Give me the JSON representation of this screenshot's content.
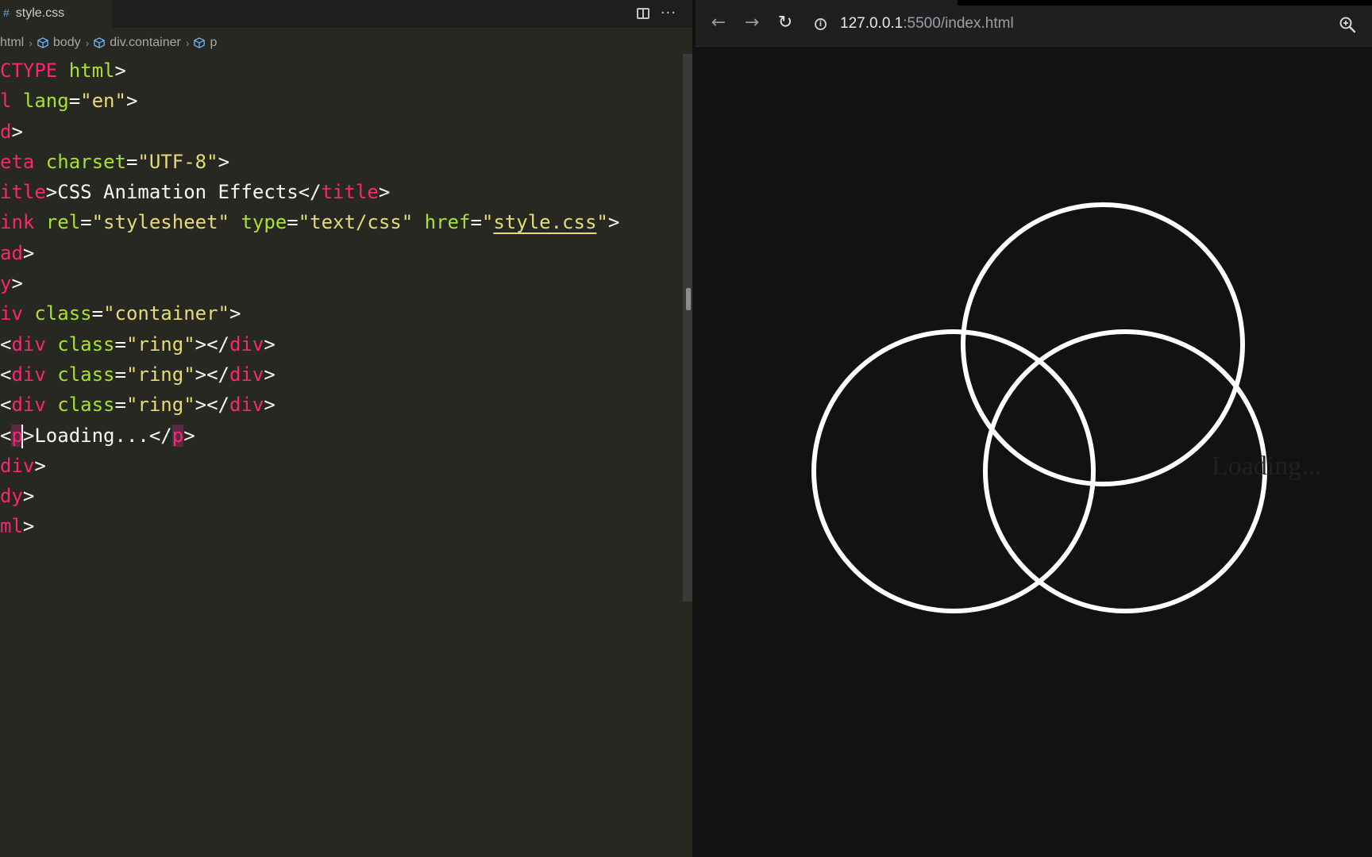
{
  "editor": {
    "tab_label": "style.css",
    "breadcrumb": [
      "html",
      "body",
      "div.container",
      "p"
    ],
    "lines": [
      [
        [
          "t",
          "CTYPE "
        ],
        [
          "a",
          "html"
        ],
        [
          "p",
          ">"
        ]
      ],
      [
        [
          "t",
          "l "
        ],
        [
          "a",
          "lang"
        ],
        [
          "p",
          "="
        ],
        [
          "s",
          "\"en\""
        ],
        [
          "p",
          ">"
        ]
      ],
      [
        [
          "t",
          "d"
        ],
        [
          "p",
          ">"
        ]
      ],
      [
        [
          "t",
          "eta "
        ],
        [
          "a",
          "charset"
        ],
        [
          "p",
          "="
        ],
        [
          "s",
          "\"UTF-8\""
        ],
        [
          "p",
          ">"
        ]
      ],
      [
        [
          "t",
          "itle"
        ],
        [
          "p",
          ">CSS Animation Effects</"
        ],
        [
          "t",
          "title"
        ],
        [
          "p",
          ">"
        ]
      ],
      [
        [
          "t",
          "ink "
        ],
        [
          "a",
          "rel"
        ],
        [
          "p",
          "="
        ],
        [
          "s",
          "\"stylesheet\" "
        ],
        [
          "a",
          "type"
        ],
        [
          "p",
          "="
        ],
        [
          "s",
          "\"text/css\" "
        ],
        [
          "a",
          "href"
        ],
        [
          "p",
          "="
        ],
        [
          "s",
          "\""
        ],
        [
          "su",
          "style.css"
        ],
        [
          "s",
          "\""
        ],
        [
          "p",
          ">"
        ]
      ],
      [
        [
          "t",
          "ad"
        ],
        [
          "p",
          ">"
        ]
      ],
      [
        [
          "t",
          "y"
        ],
        [
          "p",
          ">"
        ]
      ],
      [
        [
          "t",
          "iv "
        ],
        [
          "a",
          "class"
        ],
        [
          "p",
          "="
        ],
        [
          "s",
          "\"container\""
        ],
        [
          "p",
          ">"
        ]
      ],
      [
        [
          "p",
          "<"
        ],
        [
          "t",
          "div "
        ],
        [
          "a",
          "class"
        ],
        [
          "p",
          "="
        ],
        [
          "s",
          "\"ring\""
        ],
        [
          "p",
          "></"
        ],
        [
          "t",
          "div"
        ],
        [
          "p",
          ">"
        ]
      ],
      [
        [
          "p",
          "<"
        ],
        [
          "t",
          "div "
        ],
        [
          "a",
          "class"
        ],
        [
          "p",
          "="
        ],
        [
          "s",
          "\"ring\""
        ],
        [
          "p",
          "></"
        ],
        [
          "t",
          "div"
        ],
        [
          "p",
          ">"
        ]
      ],
      [
        [
          "p",
          "<"
        ],
        [
          "t",
          "div "
        ],
        [
          "a",
          "class"
        ],
        [
          "p",
          "="
        ],
        [
          "s",
          "\"ring\""
        ],
        [
          "p",
          "></"
        ],
        [
          "t",
          "div"
        ],
        [
          "p",
          ">"
        ]
      ],
      [
        [
          "p",
          "<"
        ],
        [
          "tsel",
          "p"
        ],
        [
          "cur",
          ""
        ],
        [
          "p",
          ">Loading...</"
        ],
        [
          "tsel",
          "p"
        ],
        [
          "p",
          ">"
        ]
      ],
      [
        [
          "t",
          "div"
        ],
        [
          "p",
          ">"
        ]
      ],
      [
        [
          "t",
          "dy"
        ],
        [
          "p",
          ">"
        ]
      ],
      [
        [
          "t",
          "ml"
        ],
        [
          "p",
          ">"
        ]
      ]
    ]
  },
  "browser": {
    "url_host": "127.0.0.1",
    "url_rest": ":5500/index.html",
    "loading_text": "Loading..."
  },
  "icons": {
    "back": "arrow-left-icon",
    "forward": "arrow-right-icon",
    "reload": "reload-icon",
    "info": "info-icon",
    "zoom": "zoom-icon",
    "split": "split-editor-icon",
    "more": "more-actions-icon"
  }
}
